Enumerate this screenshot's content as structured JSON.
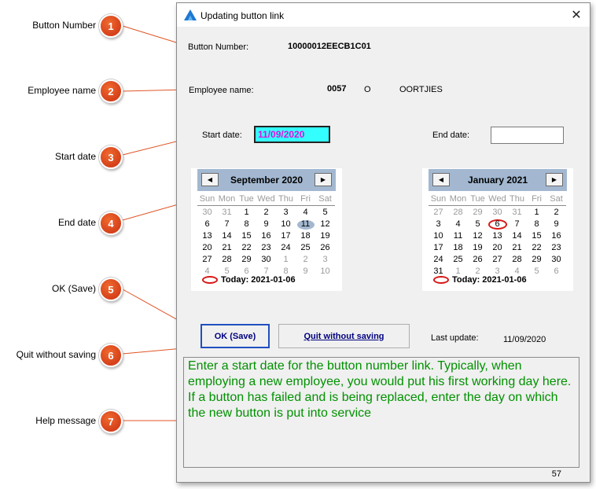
{
  "callouts": [
    {
      "num": "1",
      "label": "Button Number"
    },
    {
      "num": "2",
      "label": "Employee name"
    },
    {
      "num": "3",
      "label": "Start date"
    },
    {
      "num": "4",
      "label": "End date"
    },
    {
      "num": "5",
      "label": "OK (Save)"
    },
    {
      "num": "6",
      "label": "Quit without saving"
    },
    {
      "num": "7",
      "label": "Help message"
    }
  ],
  "colors": {
    "accent": "#e05526",
    "calendar_header": "#a3b8d0",
    "start_date_bg": "#33ffff",
    "start_date_text": "#e010e0",
    "help_text": "#009100",
    "button_text": "#000080",
    "today_ring": "#d81818"
  },
  "window": {
    "title": "Updating button link",
    "close_icon": "close-icon",
    "app_icon": "app-logo-icon"
  },
  "form": {
    "button_number_label": "Button Number:",
    "button_number_value": "10000012EECB1C01",
    "employee_label": "Employee name:",
    "employee_code": "0057",
    "employee_initial": "O",
    "employee_surname": "OORTJIES",
    "start_date_label": "Start date:",
    "start_date_value": "11/09/2020",
    "end_date_label": "End date:",
    "end_date_value": ""
  },
  "calendars": [
    {
      "title": "September 2020",
      "weekdays": [
        "Sun",
        "Mon",
        "Tue",
        "Wed",
        "Thu",
        "Fri",
        "Sat"
      ],
      "weeks": [
        [
          "30",
          "31",
          "1",
          "2",
          "3",
          "4",
          "5"
        ],
        [
          "6",
          "7",
          "8",
          "9",
          "10",
          "11",
          "12"
        ],
        [
          "13",
          "14",
          "15",
          "16",
          "17",
          "18",
          "19"
        ],
        [
          "20",
          "21",
          "22",
          "23",
          "24",
          "25",
          "26"
        ],
        [
          "27",
          "28",
          "29",
          "30",
          "1",
          "2",
          "3"
        ],
        [
          "4",
          "5",
          "6",
          "7",
          "8",
          "9",
          "10"
        ]
      ],
      "dim_first_week_count": 2,
      "dim_last_from": "row4col4",
      "selected_day": "11",
      "today_label": "Today: 2021-01-06"
    },
    {
      "title": "January 2021",
      "weekdays": [
        "Sun",
        "Mon",
        "Tue",
        "Wed",
        "Thu",
        "Fri",
        "Sat"
      ],
      "weeks": [
        [
          "27",
          "28",
          "29",
          "30",
          "31",
          "1",
          "2"
        ],
        [
          "3",
          "4",
          "5",
          "6",
          "7",
          "8",
          "9"
        ],
        [
          "10",
          "11",
          "12",
          "13",
          "14",
          "15",
          "16"
        ],
        [
          "17",
          "18",
          "19",
          "20",
          "21",
          "22",
          "23"
        ],
        [
          "24",
          "25",
          "26",
          "27",
          "28",
          "29",
          "30"
        ],
        [
          "31",
          "1",
          "2",
          "3",
          "4",
          "5",
          "6"
        ]
      ],
      "today_day": "6",
      "today_label": "Today: 2021-01-06"
    }
  ],
  "buttons": {
    "ok_label": "OK (Save)",
    "quit_label": "Quit without saving"
  },
  "last_update": {
    "label": "Last update:",
    "value": "11/09/2020"
  },
  "help": {
    "message": "Enter a start date for the button number link. Typically, when employing a new employee, you would put his first working day here. If a button has failed and is being replaced, enter the day on which the new button is put into service"
  },
  "footer": {
    "count": "57"
  }
}
